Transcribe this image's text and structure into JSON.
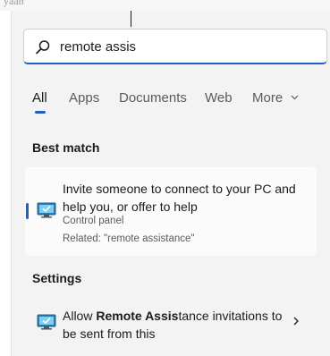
{
  "background": {
    "fragment": "yaah"
  },
  "search": {
    "value": "remote assis",
    "icon": "search-icon"
  },
  "tabs": [
    {
      "label": "All",
      "active": true
    },
    {
      "label": "Apps",
      "active": false
    },
    {
      "label": "Documents",
      "active": false
    },
    {
      "label": "Web",
      "active": false
    },
    {
      "label": "More",
      "active": false,
      "icon": "chevron-down-icon"
    }
  ],
  "best_match": {
    "heading": "Best match",
    "title": "Invite someone to connect to your PC and help you, or offer to help",
    "subtitle": "Control panel",
    "related": "Related: \"remote assistance\"",
    "icon": "monitor-check-icon"
  },
  "settings": {
    "heading": "Settings",
    "item": {
      "prefix": "Allow ",
      "bold": "Remote Assis",
      "suffix": "tance invitations to be sent from this",
      "icon": "monitor-check-icon",
      "chevron": "chevron-right-icon"
    }
  },
  "colors": {
    "accent": "#1f5fbf",
    "panel": "#f3f3f3",
    "card": "#fbfbfb"
  }
}
